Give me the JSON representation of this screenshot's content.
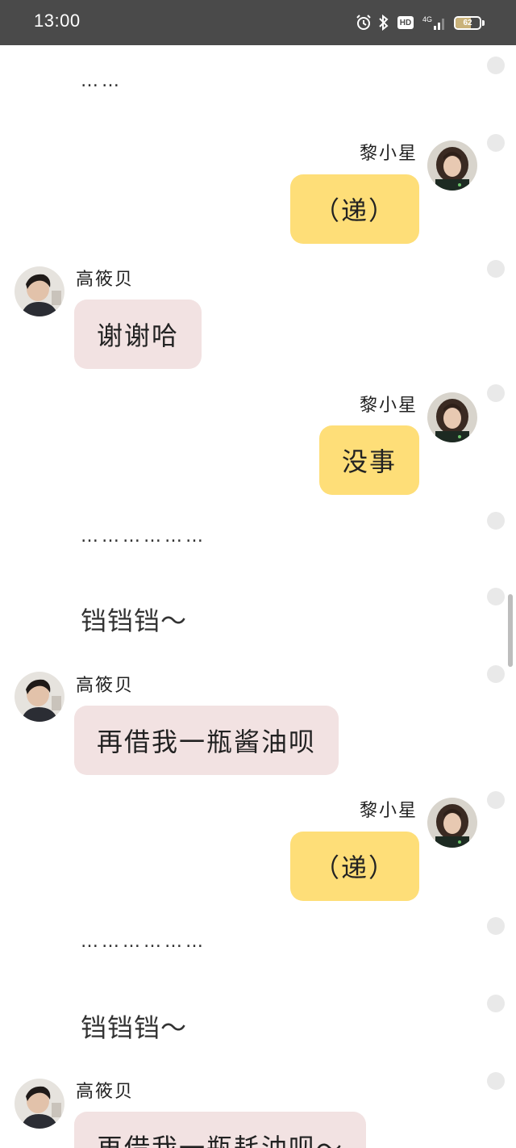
{
  "status_bar": {
    "time": "13:00",
    "icons": [
      "alarm-icon",
      "bluetooth-icon",
      "hd-icon",
      "4g-signal-icon",
      "battery-icon"
    ],
    "hd_label": "HD",
    "network_label": "4G",
    "battery_level": "62"
  },
  "characters": {
    "right": "黎小星",
    "left": "高筱贝"
  },
  "colors": {
    "right_bubble": "#fede78",
    "left_bubble": "#f2e2e2",
    "status_bar": "#4a4a4a"
  },
  "messages": [
    {
      "type": "narration",
      "text": "……"
    },
    {
      "type": "bubble",
      "side": "right",
      "name": "黎小星",
      "text": "（递）"
    },
    {
      "type": "bubble",
      "side": "left",
      "name": "高筱贝",
      "text": "谢谢哈"
    },
    {
      "type": "bubble",
      "side": "right",
      "name": "黎小星",
      "text": "没事"
    },
    {
      "type": "narration",
      "text": "………………"
    },
    {
      "type": "narration",
      "text": "铛铛铛～"
    },
    {
      "type": "bubble",
      "side": "left",
      "name": "高筱贝",
      "text": "再借我一瓶酱油呗"
    },
    {
      "type": "bubble",
      "side": "right",
      "name": "黎小星",
      "text": "（递）"
    },
    {
      "type": "narration",
      "text": "………………"
    },
    {
      "type": "narration",
      "text": "铛铛铛～"
    },
    {
      "type": "bubble",
      "side": "left",
      "name": "高筱贝",
      "text": "再借我一瓶耗油呗～"
    }
  ]
}
